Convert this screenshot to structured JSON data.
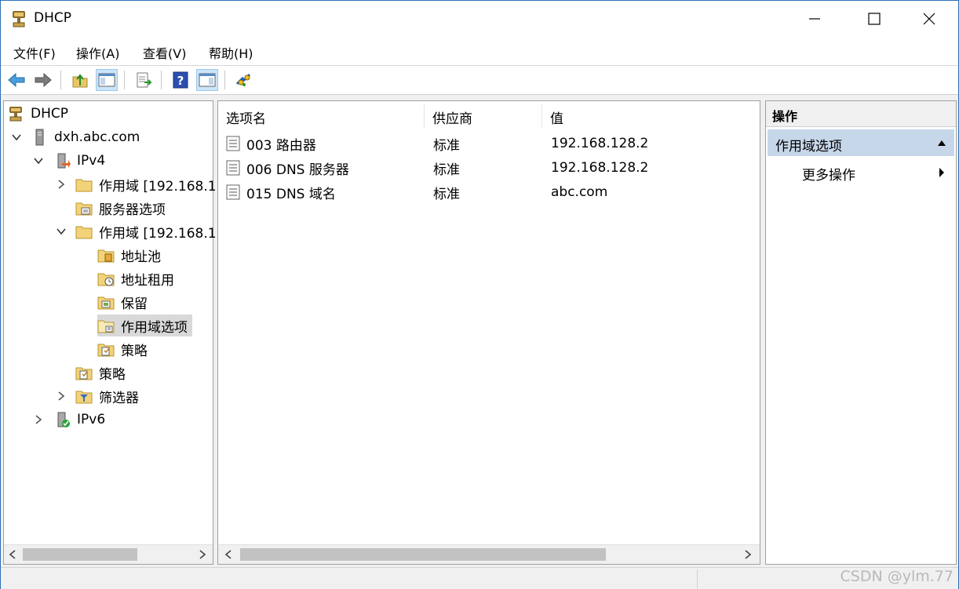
{
  "window": {
    "title": "DHCP"
  },
  "menu": [
    "文件(F)",
    "操作(A)",
    "查看(V)",
    "帮助(H)"
  ],
  "toolbar": {
    "icons": [
      "back-icon",
      "forward-icon",
      "up-icon",
      "show-tree-icon",
      "export-icon",
      "help-icon",
      "show-actions-icon",
      "refresh-scope-icon"
    ]
  },
  "tree": {
    "root": "DHCP",
    "server": "dxh.abc.com",
    "ipv4": "IPv4",
    "scope1": "作用域 [192.168.1",
    "server_options": "服务器选项",
    "scope2": "作用域 [192.168.1",
    "address_pool": "地址池",
    "address_leases": "地址租用",
    "reservations": "保留",
    "scope_options": "作用域选项",
    "policies_scope": "策略",
    "policies": "策略",
    "filters": "筛选器",
    "ipv6": "IPv6"
  },
  "list": {
    "columns": [
      "选项名",
      "供应商",
      "值"
    ],
    "rows": [
      {
        "name": "003 路由器",
        "vendor": "标准",
        "value": "192.168.128.2"
      },
      {
        "name": "006 DNS 服务器",
        "vendor": "标准",
        "value": "192.168.128.2"
      },
      {
        "name": "015 DNS 域名",
        "vendor": "标准",
        "value": "abc.com"
      }
    ]
  },
  "actions": {
    "header": "操作",
    "section": "作用域选项",
    "more": "更多操作"
  },
  "watermark": "CSDN @ylm.77",
  "colors": {
    "selection": "#d9d9d9",
    "action_section": "#c7d7ea",
    "border": "#2b6fb6"
  }
}
